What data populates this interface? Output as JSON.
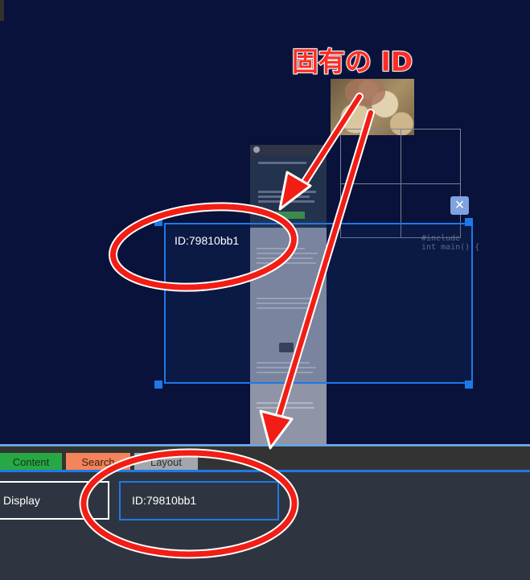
{
  "annotation": {
    "title": "固有の ID"
  },
  "canvas": {
    "selected_element": {
      "id_label": "ID:79810bb1"
    },
    "close_symbol": "×",
    "code_snippet": "#include\nint main() {"
  },
  "panel": {
    "tabs": [
      {
        "label": "Content",
        "color": "#27a844"
      },
      {
        "label": "Search",
        "color": "#f4845a"
      },
      {
        "label": "Layout",
        "color": "#a3a7ad"
      }
    ],
    "display_label": "Display",
    "id_value": "ID:79810bb1"
  },
  "colors": {
    "accent": "#1e79e8",
    "annotation": "#ff2d24",
    "background": "#08123a",
    "panel": "#2f3540"
  }
}
